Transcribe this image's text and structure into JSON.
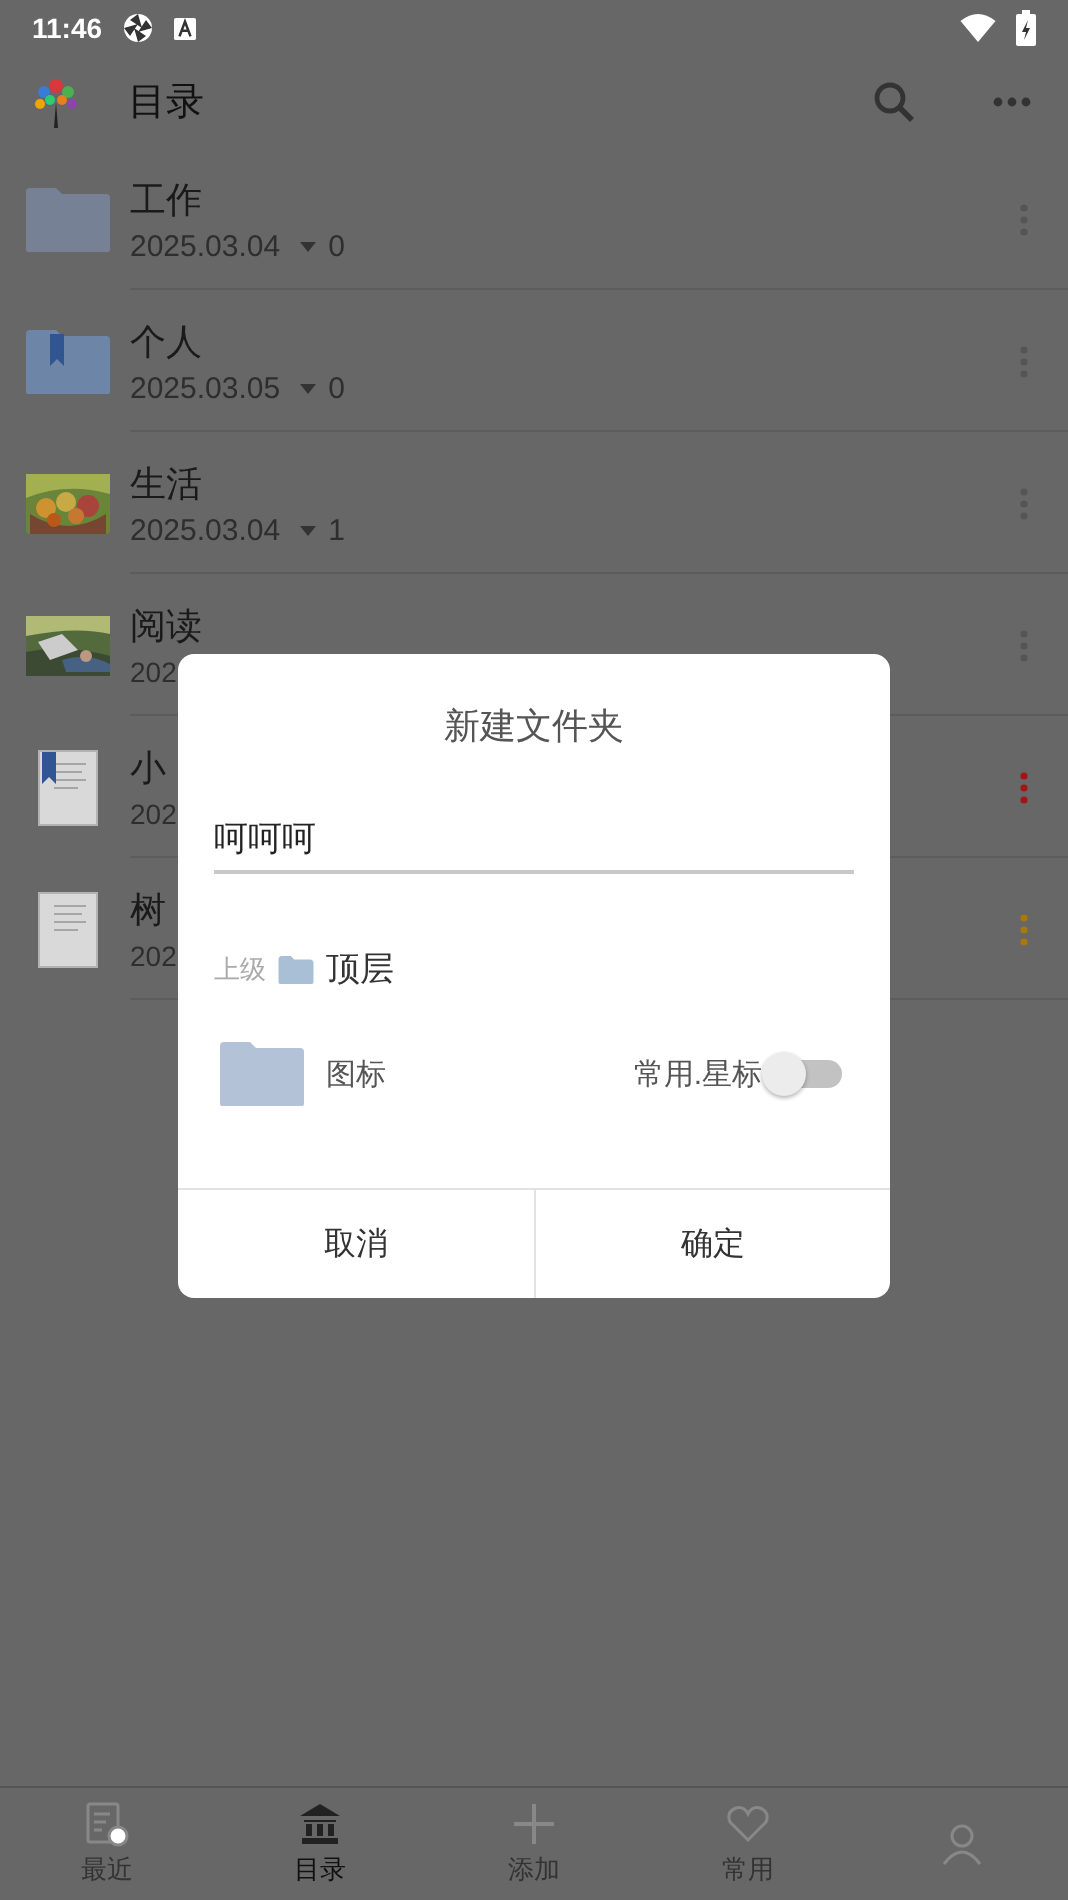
{
  "status_bar": {
    "time": "11:46"
  },
  "app_bar": {
    "title": "目录"
  },
  "items": [
    {
      "kind": "folder",
      "name": "工作",
      "date": "2025.03.04",
      "count": "0",
      "color": "#555555"
    },
    {
      "kind": "folder-bookmark",
      "name": "个人",
      "date": "2025.03.05",
      "count": "0",
      "color": "#555555"
    },
    {
      "kind": "picture",
      "name": "生活",
      "date": "2025.03.04",
      "count": "1",
      "color": "#555555"
    },
    {
      "kind": "picture",
      "name": "阅读",
      "date": "202",
      "color": "#555555"
    },
    {
      "kind": "doc-bookmark",
      "name": "小",
      "date": "202",
      "color": "#a31515"
    },
    {
      "kind": "doc",
      "name": "树",
      "date": "202",
      "color": "#a8780e"
    }
  ],
  "dialog": {
    "title": "新建文件夹",
    "name_value": "呵呵呵",
    "parent_label": "上级",
    "parent": "顶层",
    "icon_label": "图标",
    "star_label": "常用.星标",
    "star_on": false,
    "buttons": [
      "取消",
      "确定"
    ]
  },
  "nav": [
    {
      "kind": "recent",
      "label": "最近",
      "selected": false
    },
    {
      "kind": "catalog",
      "label": "目录",
      "selected": true
    },
    {
      "kind": "add",
      "label": "添加",
      "selected": false
    },
    {
      "kind": "favorite",
      "label": "常用",
      "selected": false
    },
    {
      "kind": "person",
      "selected": false
    }
  ]
}
